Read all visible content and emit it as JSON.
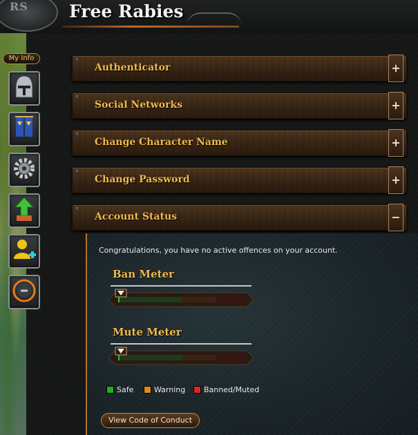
{
  "header": {
    "logo": "RS",
    "title": "Free Rabies"
  },
  "sidebar": {
    "tab_label": "My Info",
    "buttons": [
      {
        "icon": "helmet-icon"
      },
      {
        "icon": "banners-icon"
      },
      {
        "icon": "gear-icon"
      },
      {
        "icon": "upgrade-arrow-icon"
      },
      {
        "icon": "add-friend-icon"
      },
      {
        "icon": "report-icon"
      }
    ]
  },
  "sections": [
    {
      "label": "Authenticator",
      "toggle": "+"
    },
    {
      "label": "Social Networks",
      "toggle": "+"
    },
    {
      "label": "Change Character Name",
      "toggle": "+"
    },
    {
      "label": "Change Password",
      "toggle": "+"
    },
    {
      "label": "Account Status",
      "toggle": "−"
    }
  ],
  "account_status": {
    "message": "Congratulations, you have no active offences on your account.",
    "ban_meter": {
      "title": "Ban Meter",
      "level": 0
    },
    "mute_meter": {
      "title": "Mute Meter",
      "level": 0
    },
    "legend": [
      {
        "label": "Safe",
        "color": "#22b022"
      },
      {
        "label": "Warning",
        "color": "#e08a1a"
      },
      {
        "label": "Banned/Muted",
        "color": "#d8262a"
      }
    ],
    "code_of_conduct_button": "View Code of Conduct"
  },
  "colors": {
    "accent": "#f0b94d",
    "bar_brown": "#3a2716",
    "panel_teal": "#1a2428"
  }
}
